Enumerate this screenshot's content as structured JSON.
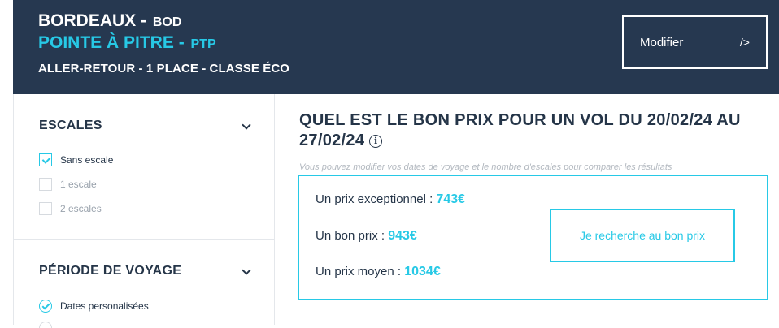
{
  "header": {
    "origin_city": "BORDEAUX",
    "origin_sep": "-",
    "origin_code": "BOD",
    "dest_city": "POINTE À PITRE",
    "dest_sep": "-",
    "dest_code": "PTP",
    "trip_summary": "ALLER-RETOUR - 1 PLACE - CLASSE ÉCO",
    "modify_label": "Modifier",
    "modify_arrow": "/>"
  },
  "sidebar": {
    "stops": {
      "title": "ESCALES",
      "options": [
        {
          "label": "Sans escale",
          "checked": true
        },
        {
          "label": "1 escale",
          "checked": false
        },
        {
          "label": "2 escales",
          "checked": false
        }
      ]
    },
    "period": {
      "title": "PÉRIODE DE VOYAGE",
      "options": [
        {
          "label": "Dates personalisées",
          "selected": true
        }
      ]
    }
  },
  "main": {
    "title": "QUEL EST LE BON PRIX POUR UN VOL DU 20/02/24 AU 27/02/24",
    "info_glyph": "i",
    "note": "Vous pouvez modifier vos dates de voyage et le nombre d'escales pour comparer les résultats",
    "prices": [
      {
        "label": "Un prix exceptionnel :",
        "value": "743€"
      },
      {
        "label": "Un bon prix :",
        "value": "943€"
      },
      {
        "label": "Un prix moyen :",
        "value": "1034€"
      }
    ],
    "search_label": "Je recherche au bon prix"
  },
  "colors": {
    "header_bg": "#263850",
    "accent": "#27c9e6",
    "text_dark": "#253548"
  }
}
